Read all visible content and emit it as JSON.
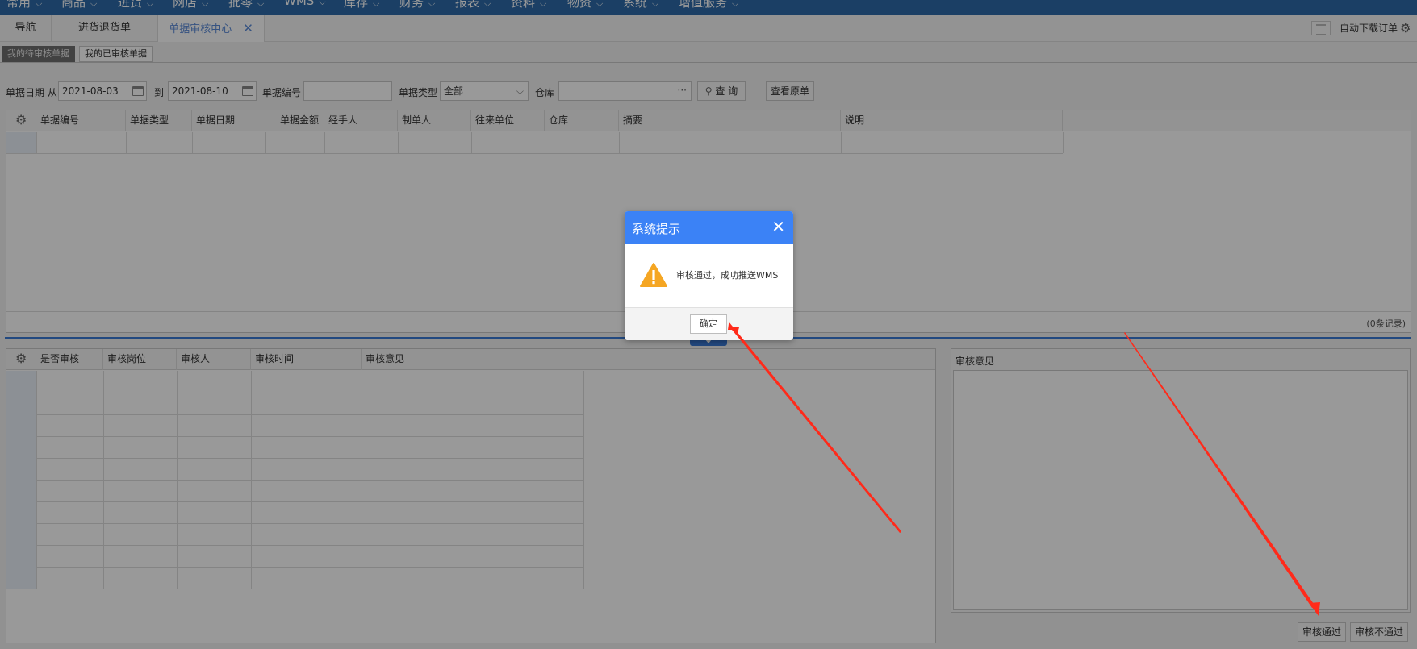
{
  "menu": {
    "items": [
      "常用",
      "商品",
      "进货",
      "网店",
      "批零",
      "WMS",
      "库存",
      "财务",
      "报表",
      "资料",
      "物资",
      "系统",
      "增值服务"
    ]
  },
  "tabs": [
    {
      "label": "导航"
    },
    {
      "label": "进货退货单"
    },
    {
      "label": "单据审核中心",
      "close": "✕"
    }
  ],
  "toolbar": {
    "auto_download": "自动下载订单"
  },
  "subtabs": [
    "我的待审核单据",
    "我的已审核单据"
  ],
  "filter": {
    "date_label": "单据日期 从",
    "date_from": "2021-08-03",
    "to_label": "到",
    "date_to": "2021-08-10",
    "bill_no_label": "单据编号",
    "bill_no_value": "",
    "bill_type_label": "单据类型",
    "bill_type_value": "全部",
    "warehouse_label": "仓库",
    "warehouse_value": "",
    "more": "···",
    "query_button": "查 询",
    "view_original_button": "查看原单"
  },
  "main_grid": {
    "columns": [
      "单据编号",
      "单据类型",
      "单据日期",
      "单据金额",
      "经手人",
      "制单人",
      "往来单位",
      "仓库",
      "摘要",
      "说明"
    ],
    "records": "(0条记录)"
  },
  "audit_grid": {
    "columns": [
      "是否审核",
      "审核岗位",
      "审核人",
      "审核时间",
      "审核意见"
    ]
  },
  "opinion": {
    "title": "审核意见",
    "value": ""
  },
  "actions": {
    "approve": "审核通过",
    "reject": "审核不通过"
  },
  "dialog": {
    "title": "系统提示",
    "close": "✕",
    "message": "审核通过，成功推送WMS",
    "ok": "确定"
  },
  "colors": {
    "menu_bg": "#2d6aa8",
    "dialog_header": "#3b82f6",
    "warning": "#f5a623",
    "arrow": "#ff2a1a",
    "active_tab_text": "#5b8ad8"
  }
}
